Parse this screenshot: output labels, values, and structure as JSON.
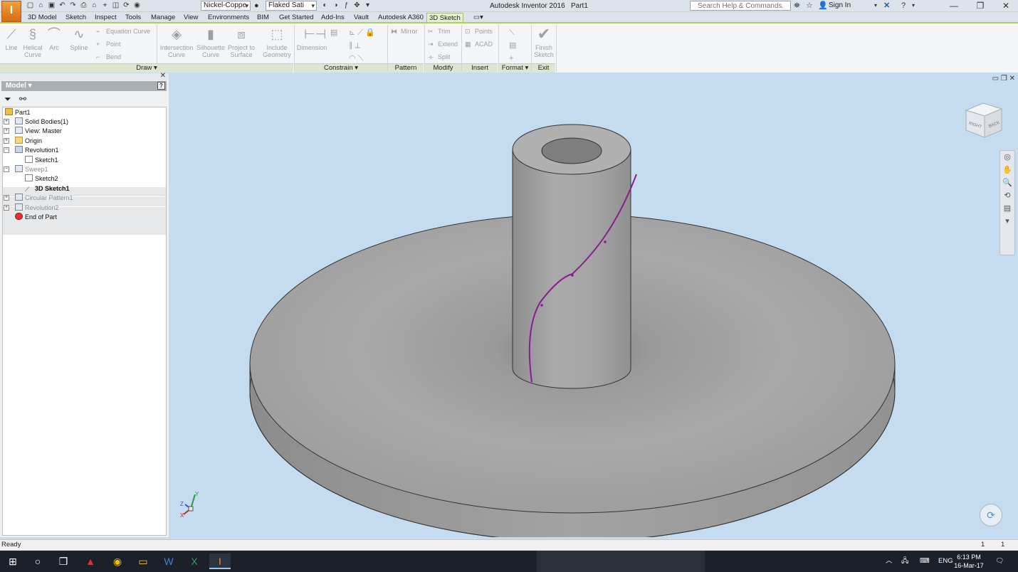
{
  "window": {
    "title": "Autodesk Inventor 2016",
    "document": "Part1"
  },
  "titlebar": {
    "material_combo": "Nickel-Coppe",
    "appearance_combo": "Flaked Sati",
    "search_placeholder": "Search Help & Commands...",
    "signin_label": "Sign In"
  },
  "tabs": [
    "3D Model",
    "Sketch",
    "Inspect",
    "Tools",
    "Manage",
    "View",
    "Environments",
    "BIM",
    "Get Started",
    "Add-Ins",
    "Vault",
    "Autodesk A360",
    "3D Sketch"
  ],
  "active_tab": "3D Sketch",
  "ribbon": {
    "draw": {
      "line": "Line",
      "helical_curve": "Helical\nCurve",
      "arc": "Arc",
      "spline": "Spline",
      "equation_curve": "Equation Curve",
      "point": "Point",
      "bend": "Bend",
      "intersection_curve": "Intersection\nCurve",
      "silhouette_curve": "Silhouette\nCurve",
      "project_to_surface": "Project to\nSurface",
      "include_geometry": "Include\nGeometry"
    },
    "constrain": {
      "dimension": "Dimension"
    },
    "pattern": {
      "mirror": "Mirror"
    },
    "modify": {
      "trim": "Trim",
      "extend": "Extend",
      "split": "Split"
    },
    "insert": {
      "points": "Points",
      "acad": "ACAD"
    },
    "exit": {
      "finish_sketch": "Finish\nSketch"
    },
    "panels": {
      "draw": "Draw ▾",
      "constrain": "Constrain ▾",
      "pattern": "Pattern",
      "modify": "Modify",
      "insert": "Insert",
      "format": "Format ▾",
      "exit": "Exit"
    }
  },
  "browser": {
    "header": "Model ▾",
    "tree": [
      {
        "label": "Part1",
        "level": 0,
        "state": "normal"
      },
      {
        "label": "Solid Bodies(1)",
        "level": 1,
        "state": "normal",
        "expander": "+"
      },
      {
        "label": "View: Master",
        "level": 1,
        "state": "normal",
        "expander": "+"
      },
      {
        "label": "Origin",
        "level": 1,
        "state": "normal",
        "expander": "+"
      },
      {
        "label": "Revolution1",
        "level": 1,
        "state": "normal",
        "expander": "−"
      },
      {
        "label": "Sketch1",
        "level": 2,
        "state": "normal"
      },
      {
        "label": "Sweep1",
        "level": 1,
        "state": "dim",
        "expander": "−"
      },
      {
        "label": "Sketch2",
        "level": 2,
        "state": "normal"
      },
      {
        "label": "3D Sketch1",
        "level": 2,
        "state": "bold"
      },
      {
        "label": "Circular Pattern1",
        "level": 1,
        "state": "dim",
        "expander": "+"
      },
      {
        "label": "Revolution2",
        "level": 1,
        "state": "dim",
        "expander": "+"
      },
      {
        "label": "End of Part",
        "level": 1,
        "state": "normal"
      }
    ]
  },
  "viewcube": {
    "face_left": "RIGHT",
    "face_right": "BACK"
  },
  "triad": {
    "x": "X",
    "y": "Y",
    "z": "Z"
  },
  "statusbar": {
    "text": "Ready",
    "count1": "1",
    "count2": "1"
  },
  "taskbar": {
    "language": "ENG",
    "time": "6:13 PM",
    "date": "16-Mar-17"
  },
  "colors": {
    "sketch_curve": "#8a1c8e",
    "ribbon_accent": "#a9d25c",
    "viewport_bg": "#c5dcf0"
  }
}
